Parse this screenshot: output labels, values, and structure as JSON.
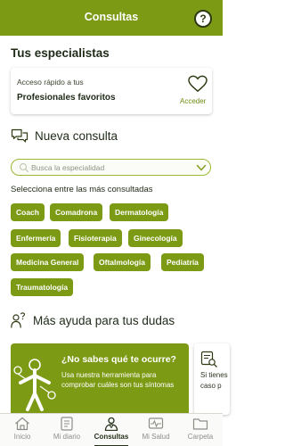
{
  "header": {
    "title": "Consultas",
    "help_glyph": "?"
  },
  "specialists": {
    "title": "Tus especialistas",
    "card": {
      "line1": "Acceso rápido a tus",
      "line2": "Profesionales favoritos",
      "action": "Acceder"
    }
  },
  "new_consult": {
    "title": "Nueva consulta",
    "search_placeholder": "Busca la especialidad",
    "subtitle": "Selecciona entre las más consultadas",
    "chips": [
      "Coach",
      "Comadrona",
      "Dermatología",
      "Enfermería",
      "Fisioterapia",
      "Ginecología",
      "Medicina General",
      "Oftalmología",
      "Pediatría",
      "Traumatología"
    ]
  },
  "help": {
    "title": "Más ayuda para tus dudas",
    "card_title": "¿No sabes qué te ocurre?",
    "card_desc": "Usa nuestra herramienta para comprobar cuáles son tus síntomas",
    "side_line1": "Si tienes",
    "side_line2": "caso p"
  },
  "tabs": [
    {
      "label": "Inicio",
      "icon": "home-icon",
      "active": false
    },
    {
      "label": "Mi diario",
      "icon": "diary-icon",
      "active": false
    },
    {
      "label": "Consultas",
      "icon": "doctor-icon",
      "active": true
    },
    {
      "label": "Mi Salud",
      "icon": "health-monitor-icon",
      "active": false
    },
    {
      "label": "Carpeta",
      "icon": "folder-icon",
      "active": false
    }
  ],
  "colors": {
    "brand": "#7d9a14",
    "text": "#1f2a18",
    "inactive_tab": "#8d8d88"
  }
}
